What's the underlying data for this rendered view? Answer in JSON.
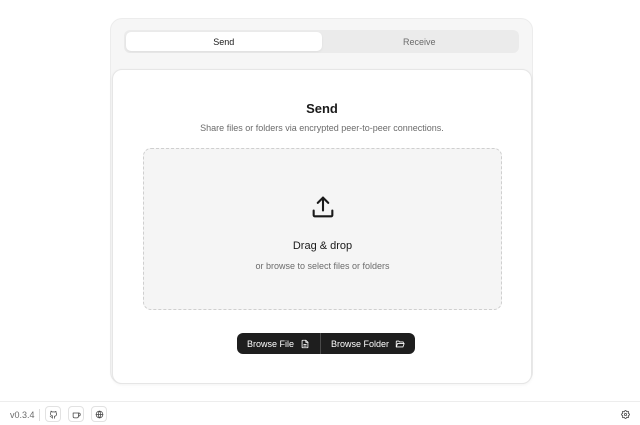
{
  "tabs": [
    {
      "label": "Send",
      "active": true
    },
    {
      "label": "Receive",
      "active": false
    }
  ],
  "card": {
    "title": "Send",
    "subtitle": "Share files or folders via encrypted peer-to-peer connections."
  },
  "dropzone": {
    "title": "Drag & drop",
    "subtitle": "or browse to select files or folders",
    "icon": "upload-icon"
  },
  "buttons": {
    "browse_file": "Browse File",
    "browse_file_icon": "file-icon",
    "browse_folder": "Browse Folder",
    "browse_folder_icon": "folder-open-icon"
  },
  "footer": {
    "version": "v0.3.4",
    "icons": [
      "github-icon",
      "coffee-icon",
      "globe-icon"
    ],
    "settings_icon": "settings-icon"
  },
  "colors": {
    "accent_button": "#1e1e1e",
    "panel_bg": "#f6f6f6",
    "dropzone_bg": "#f5f5f5"
  }
}
